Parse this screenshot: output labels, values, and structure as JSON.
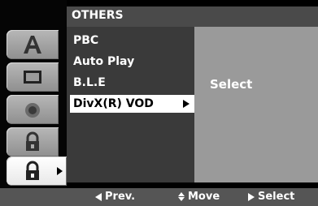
{
  "title": "OTHERS",
  "menu": {
    "items": [
      {
        "label": "PBC"
      },
      {
        "label": "Auto Play"
      },
      {
        "label": "B.L.E"
      },
      {
        "label": "DivX(R) VOD",
        "selected": true
      }
    ]
  },
  "submenu": {
    "label": "Select"
  },
  "footer": {
    "prev": "Prev.",
    "move": "Move",
    "select": "Select"
  },
  "tabs": [
    {
      "name": "language-icon"
    },
    {
      "name": "display-icon"
    },
    {
      "name": "audio-icon"
    },
    {
      "name": "lock-icon"
    },
    {
      "name": "others-lock-icon",
      "active": true
    }
  ],
  "colors": {
    "title_bar": "#4a4a4a",
    "menu_panel": "#3a3a3a",
    "sub_panel": "#9a9a9a",
    "footer": "#555555",
    "selected_bg": "#ffffff"
  }
}
